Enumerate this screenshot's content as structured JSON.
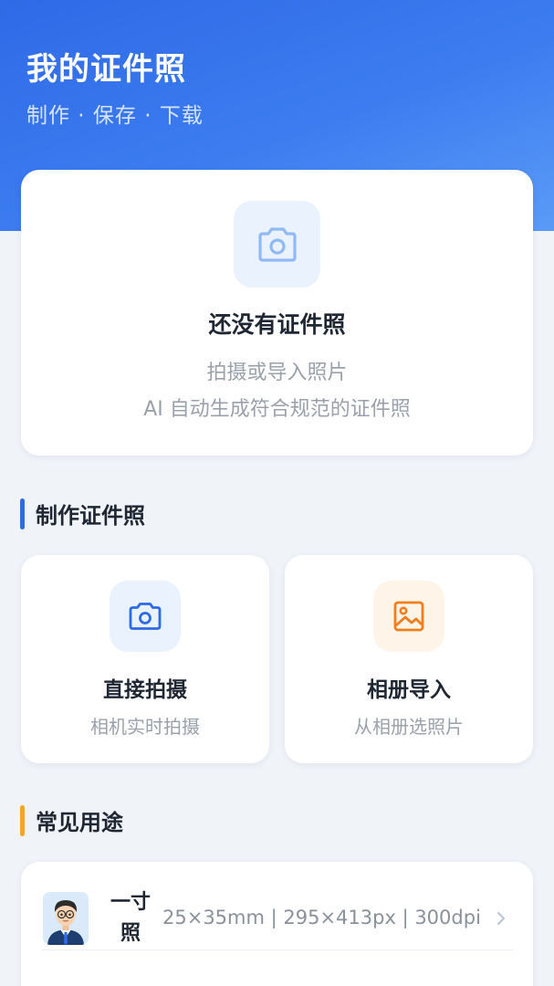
{
  "header": {
    "title": "我的证件照",
    "subtitle": "制作 · 保存 · 下载"
  },
  "empty_state": {
    "icon": "camera-icon",
    "title": "还没有证件照",
    "desc_line1": "拍摄或导入照片",
    "desc_line2": "AI 自动生成符合规范的证件照"
  },
  "make_section": {
    "title": "制作证件照",
    "accent": "#2f6ae6",
    "actions": [
      {
        "icon": "camera-icon",
        "title": "直接拍摄",
        "desc": "相机实时拍摄",
        "color": "#2f6ae6",
        "bg": "#eaf2fe"
      },
      {
        "icon": "image-icon",
        "title": "相册导入",
        "desc": "从相册选照片",
        "color": "#f07d1e",
        "bg": "#fef4e7"
      }
    ]
  },
  "uses_section": {
    "title": "常见用途",
    "accent": "#f5a623",
    "items": [
      {
        "icon": "avatar-icon",
        "name_line1": "一寸",
        "name_line2": "照",
        "spec": "25×35mm | 295×413px | 300dpi"
      }
    ]
  },
  "colors": {
    "primary": "#2f6ae6",
    "text_main": "#1f2733",
    "text_muted": "#9aa1ab",
    "background": "#f0f3f8"
  }
}
